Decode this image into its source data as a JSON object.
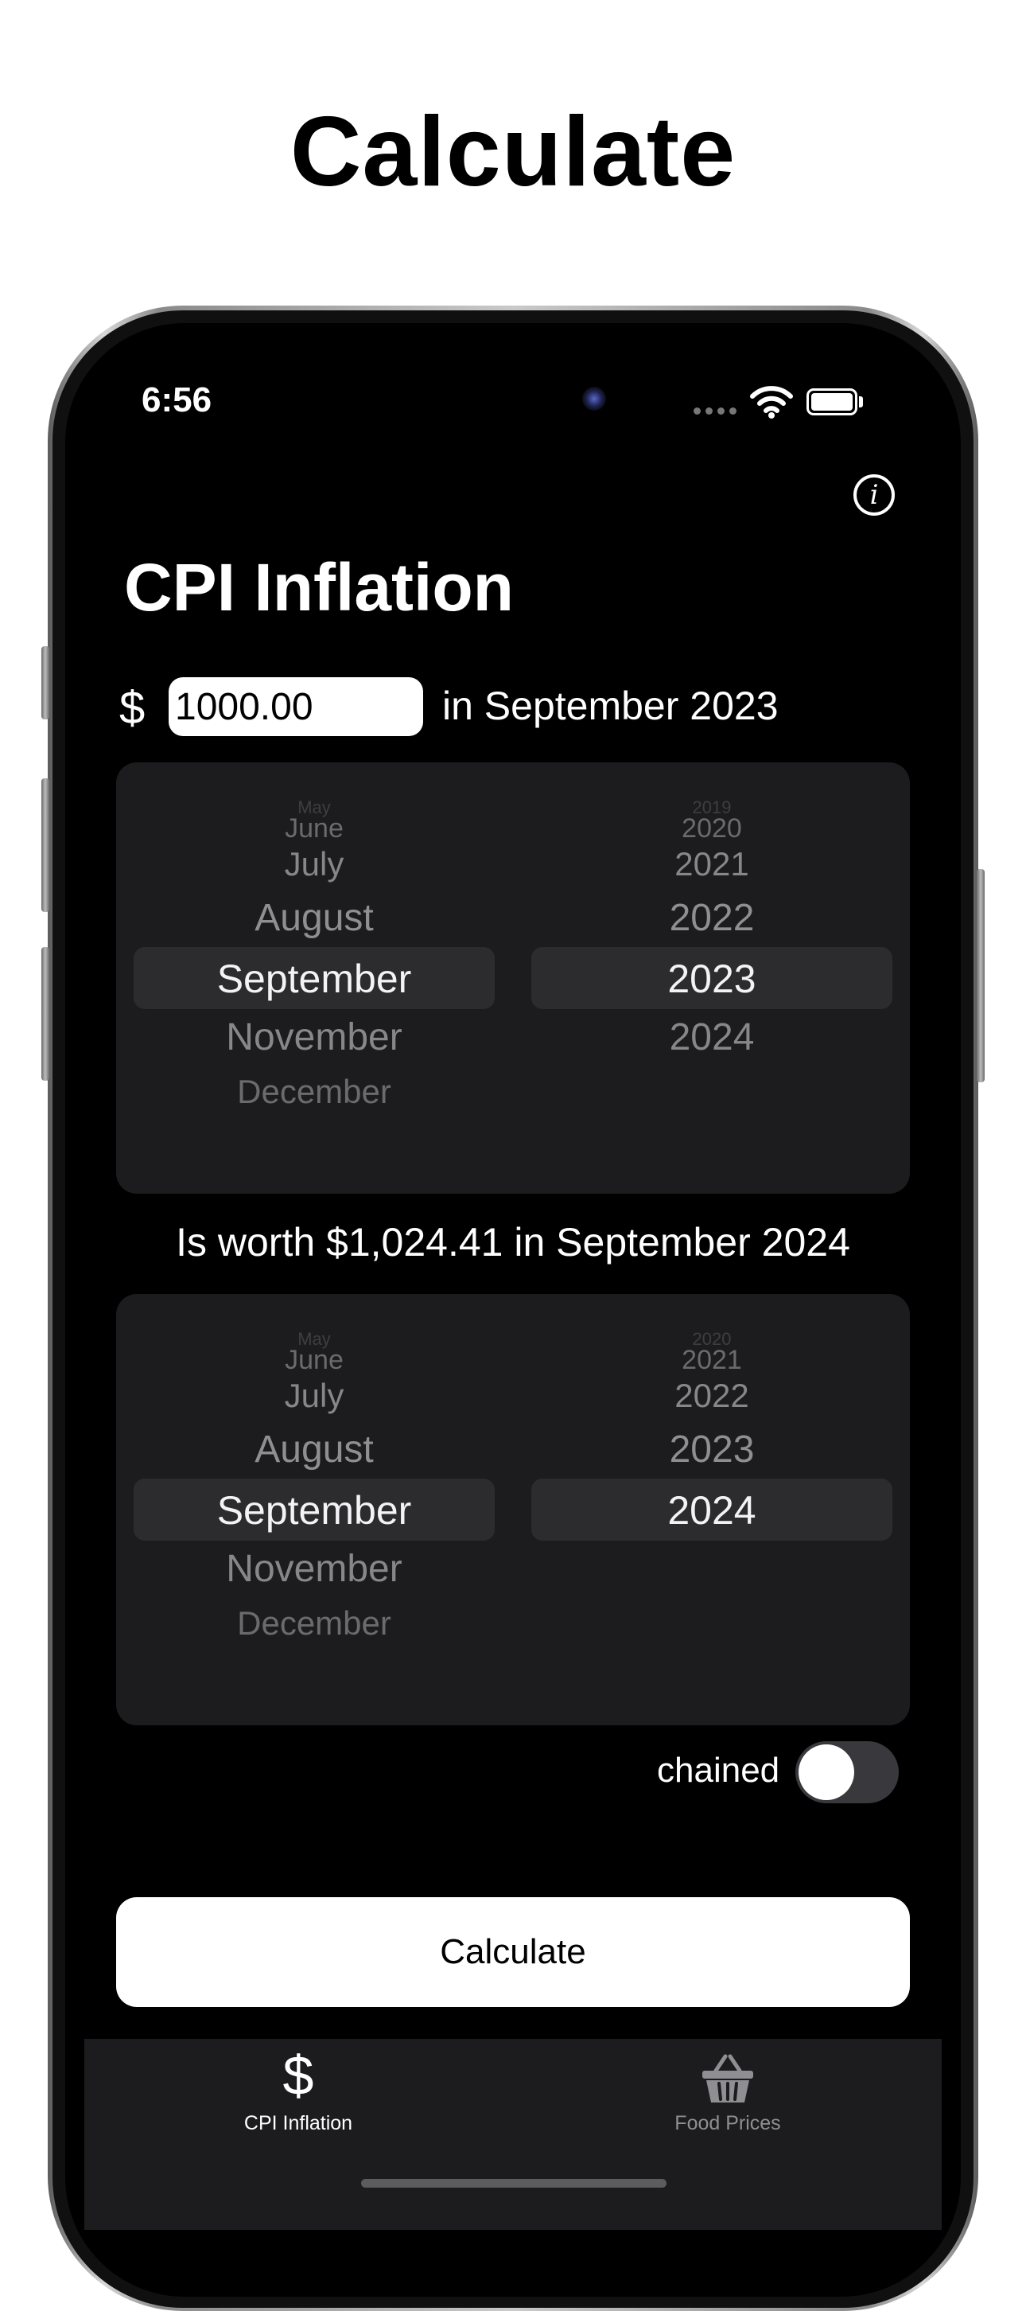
{
  "headline": "Calculate",
  "status_bar": {
    "time": "6:56"
  },
  "app": {
    "title": "CPI Inflation",
    "currency_symbol": "$",
    "amount_value": "1000.00",
    "start_label": "in September 2023",
    "result_text": "Is worth $1,024.41 in September 2024",
    "chained_label": "chained",
    "chained_on": false,
    "calculate_label": "Calculate"
  },
  "start_picker": {
    "months": [
      "May",
      "June",
      "July",
      "August",
      "September",
      "November",
      "December"
    ],
    "years": [
      "2019",
      "2020",
      "2021",
      "2022",
      "2023",
      "2024"
    ],
    "selected_month": "September",
    "selected_year": "2023"
  },
  "end_picker": {
    "months": [
      "May",
      "June",
      "July",
      "August",
      "September",
      "November",
      "December"
    ],
    "years": [
      "2020",
      "2021",
      "2022",
      "2023",
      "2024"
    ],
    "selected_month": "September",
    "selected_year": "2024"
  },
  "tab_bar": {
    "tabs": [
      {
        "label": "CPI Inflation",
        "icon": "dollar-icon",
        "active": true
      },
      {
        "label": "Food Prices",
        "icon": "basket-icon",
        "active": false
      }
    ]
  },
  "colors": {
    "screen_bg": "#000000",
    "picker_bg": "#1c1c1e",
    "selection_band": "#2c2c2e",
    "tab_active": "#ffffff",
    "tab_inactive": "#8e8e93"
  }
}
